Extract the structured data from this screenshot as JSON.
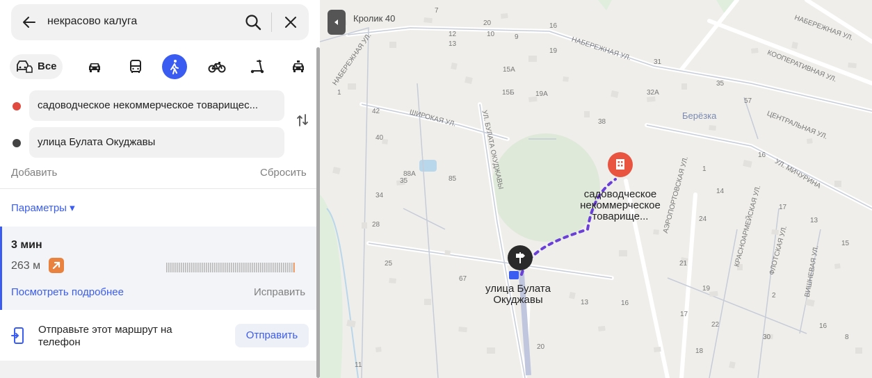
{
  "search": {
    "query": "некрасово калуга"
  },
  "modes": {
    "all_label": "Все",
    "accent": "#3a5cf0"
  },
  "waypoints": {
    "from": "садоводческое некоммерческое товарищес...",
    "to": "улица Булата Окуджавы",
    "from_color": "#e04a3f",
    "to_color": "#444444"
  },
  "actions": {
    "add": "Добавить",
    "reset": "Сбросить"
  },
  "params": {
    "label": "Параметры ▾"
  },
  "route": {
    "time": "3 мин",
    "distance": "263 м",
    "details": "Посмотреть подробнее",
    "fix": "Исправить"
  },
  "send": {
    "text": "Отправьте этот маршрут на телефон",
    "button": "Отправить"
  },
  "map": {
    "streets": {
      "naberezhnaya1": "НАБЕРЕЖНАЯ УЛ.",
      "naberezhnaya2": "НАБЕРЕЖНАЯ УЛ.",
      "naberezhnaya3": "НАБЕРЕЖНАЯ УЛ.",
      "shirokaya": "ШИРОКАЯ УЛ.",
      "okudzhavy": "УЛ. БУЛАТА ОКУДЖАВЫ",
      "kooperativnaya": "КООПЕРАТИВНАЯ УЛ.",
      "centralnaya": "ЦЕНТРАЛЬНАЯ УЛ.",
      "michurina": "УЛ. МИЧУРИНА",
      "aeroport": "АЭРОПОРТОВСКАЯ УЛ.",
      "krasnoarm": "КРАСНОАРМЕЙСКАЯ УЛ.",
      "flotskaya": "ФЛОТСКАЯ УЛ.",
      "vishnevaya": "ВИШНЕВАЯ УЛ."
    },
    "poi": {
      "krolik": "Кролик 40",
      "berezka": "Берёзка"
    },
    "destination_label": "садоводческое некоммерческое товарище...",
    "start_label": "улица Булата Окуджавы",
    "house_numbers": [
      "7",
      "16",
      "20",
      "12",
      "10",
      "9",
      "31",
      "13",
      "19",
      "15А",
      "15Б",
      "19А",
      "35",
      "32А",
      "57",
      "38",
      "42",
      "40",
      "35",
      "88А",
      "85",
      "34",
      "16",
      "14",
      "28",
      "17",
      "13",
      "24",
      "25",
      "15",
      "21",
      "67",
      "19",
      "16",
      "13",
      "17",
      "22",
      "16",
      "30",
      "20",
      "11",
      "18",
      "8",
      "2",
      "1",
      "1"
    ]
  }
}
